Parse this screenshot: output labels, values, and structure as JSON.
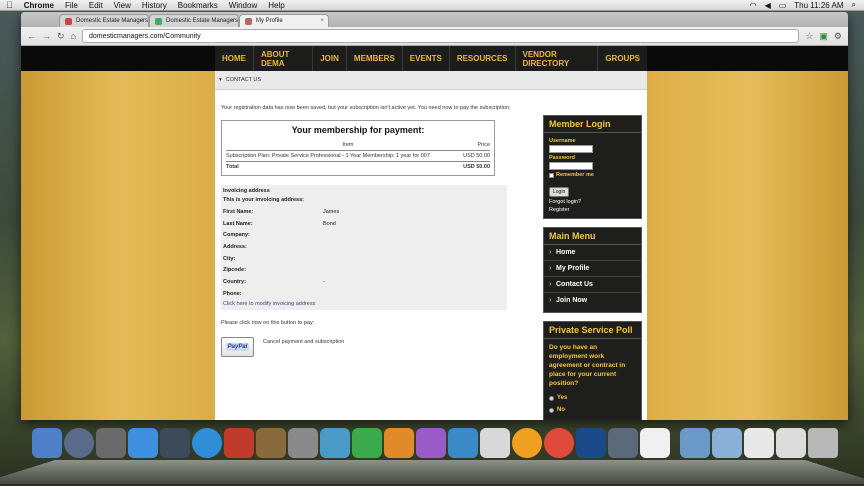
{
  "menubar": {
    "apple": "",
    "app": "Chrome",
    "items": [
      "File",
      "Edit",
      "View",
      "History",
      "Bookmarks",
      "Window",
      "Help"
    ],
    "clock": "Thu 11:26 AM"
  },
  "tabs": [
    {
      "label": "Domestic Estate Managers",
      "color": "#c44"
    },
    {
      "label": "Domestic Estate Managers",
      "color": "#4a6"
    },
    {
      "label": "My Profile",
      "color": "#b66"
    }
  ],
  "address": {
    "url": "domesticmanagers.com/Community"
  },
  "nav": [
    "HOME",
    "ABOUT DEMA",
    "JOIN",
    "MEMBERS",
    "EVENTS",
    "RESOURCES",
    "VENDOR DIRECTORY",
    "GROUPS"
  ],
  "breadcrumb": "CONTACT US",
  "main": {
    "notice": "Your registration data has now been saved, but your subscription isn't active yet. You need now to pay the subscription:",
    "payment": {
      "title": "Your membership for payment:",
      "col_item": "Item",
      "col_price": "Price",
      "item": "Subscription Plan: Private Service Professional - 1 Year Membership: 1 year for 007",
      "item_price": "USD 50.00",
      "total_label": "Total",
      "total_price": "USD 50.00"
    },
    "invoice": {
      "title": "Invoicing address",
      "subtitle": "This is your invoicing address:",
      "fields": [
        {
          "label": "First Name:",
          "value": "James"
        },
        {
          "label": "Last Name:",
          "value": "Bond"
        },
        {
          "label": "Company:",
          "value": ""
        },
        {
          "label": "Address:",
          "value": ""
        },
        {
          "label": "City:",
          "value": ""
        },
        {
          "label": "Zipcode:",
          "value": ""
        },
        {
          "label": "Country:",
          "value": "-"
        },
        {
          "label": "Phone:",
          "value": ""
        }
      ],
      "modify": "Click here to modify invoicing address"
    },
    "pay_prompt": "Please click now on this button to pay:",
    "paypal": "PayPal",
    "cancel": "Cancel payment and subscription"
  },
  "login": {
    "title": "Member Login",
    "username": "Username",
    "password": "Password",
    "remember": "Remember me",
    "button": "Login",
    "forgot": "Forgot login?",
    "register": "Register"
  },
  "menu": {
    "title": "Main Menu",
    "items": [
      "Home",
      "My Profile",
      "Contact Us",
      "Join Now"
    ]
  },
  "poll": {
    "title": "Private Service Poll",
    "question": "Do you have an employment work agreement or contract in place for your current position?",
    "options": [
      "Yes",
      "No"
    ]
  }
}
